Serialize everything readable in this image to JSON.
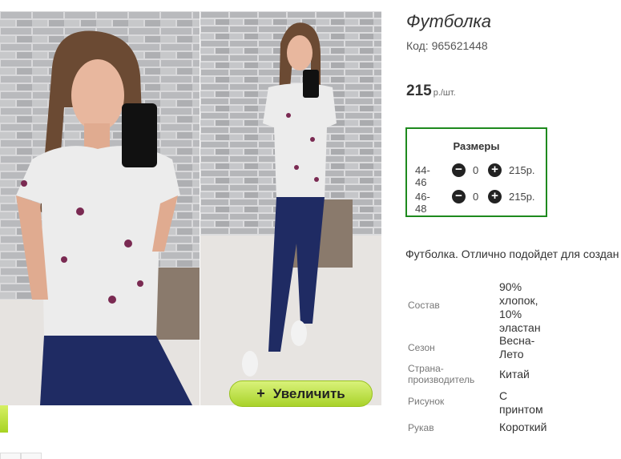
{
  "product": {
    "title": "Футболка",
    "code": "Код: 965621448",
    "price": "215",
    "price_unit": "р./шт.",
    "zoom_label": "Увеличить",
    "zoom_icon": "plus-icon",
    "description": "Футболка. Отлично подойдет для создан"
  },
  "sizes": {
    "header": "Размеры",
    "rows": [
      {
        "size": "44-46",
        "qty": "0",
        "price": "215р."
      },
      {
        "size": "46-48",
        "qty": "0",
        "price": "215р."
      }
    ]
  },
  "specs": [
    {
      "label": "Состав",
      "value": "90% хлопок, 10% эластан"
    },
    {
      "label": "Сезон",
      "value": "Весна-Лето"
    },
    {
      "label": "Страна-производитель",
      "value": "Китай"
    },
    {
      "label": "Рисунок",
      "value": "С принтом"
    },
    {
      "label": "Рукав",
      "value": "Короткий"
    }
  ],
  "colors": {
    "accent_green": "#1e8a1e",
    "zoom_button": "#b5dc34"
  }
}
